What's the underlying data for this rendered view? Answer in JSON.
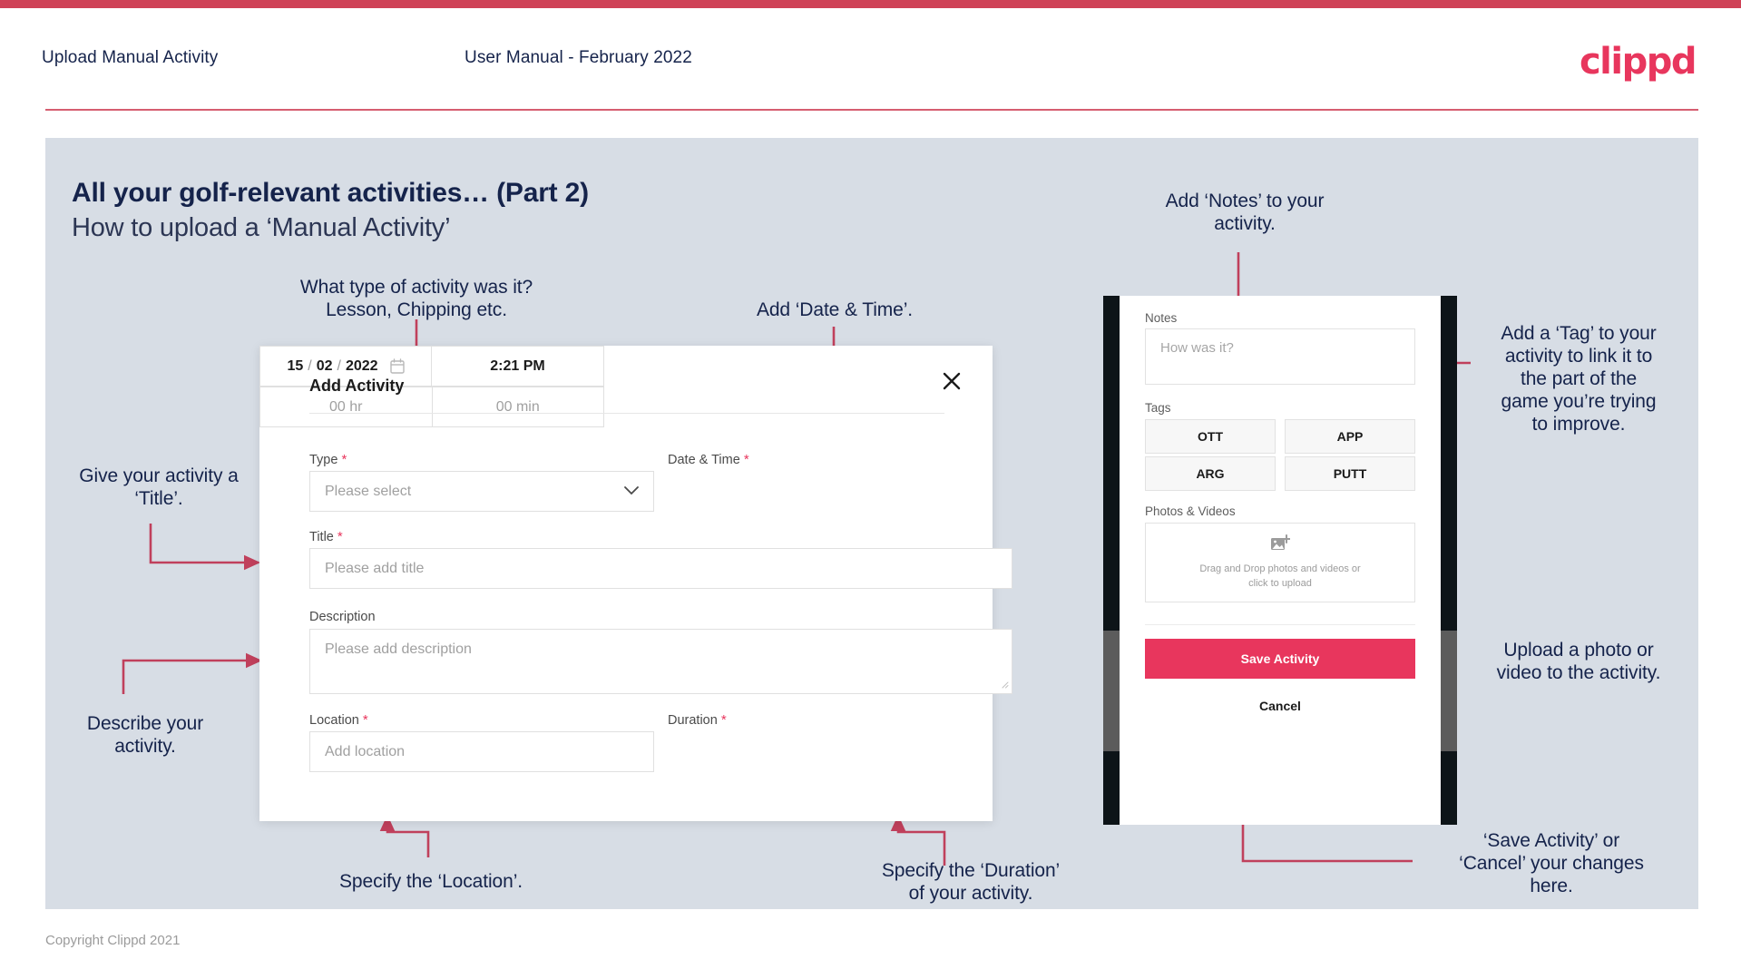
{
  "header": {
    "left_title": "Upload Manual Activity",
    "center_title": "User Manual - February 2022",
    "logo": "clippd"
  },
  "slide": {
    "title_line1": "All your golf-relevant activities… (Part 2)",
    "title_line2": "How to upload a ‘Manual Activity’"
  },
  "dialog": {
    "title": "Add Activity",
    "close_icon": "close-icon",
    "fields": {
      "type": {
        "label": "Type",
        "required": "*",
        "placeholder": "Please select",
        "chevron_icon": "chevron-down-icon"
      },
      "date_time": {
        "label": "Date & Time",
        "required": "*",
        "day": "15",
        "sep1": "/",
        "month": "02",
        "sep2": "/",
        "year": "2022",
        "calendar_icon": "calendar-icon",
        "time": "2:21 PM"
      },
      "title": {
        "label": "Title",
        "required": "*",
        "placeholder": "Please add title"
      },
      "description": {
        "label": "Description",
        "placeholder": "Please add description"
      },
      "location": {
        "label": "Location",
        "required": "*",
        "placeholder": "Add location"
      },
      "duration": {
        "label": "Duration",
        "required": "*",
        "hours_placeholder": "00 hr",
        "minutes_placeholder": "00 min"
      }
    }
  },
  "phone": {
    "notes": {
      "label": "Notes",
      "placeholder": "How was it?"
    },
    "tags": {
      "label": "Tags",
      "items": [
        "OTT",
        "APP",
        "ARG",
        "PUTT"
      ]
    },
    "photos_videos": {
      "label": "Photos & Videos",
      "upload_icon": "add-image-icon",
      "hint_line1": "Drag and Drop photos and videos or",
      "hint_line2": "click to upload"
    },
    "save_label": "Save Activity",
    "cancel_label": "Cancel"
  },
  "annotations": {
    "type": "What type of activity was it?\nLesson, Chipping etc.",
    "date_time": "Add ‘Date & Time’.",
    "title": "Give your activity a\n‘Title’.",
    "description": "Describe your\nactivity.",
    "location": "Specify the ‘Location’.",
    "duration": "Specify the ‘Duration’\nof your activity.",
    "notes": "Add ‘Notes’ to your\nactivity.",
    "tags": "Add a ‘Tag’ to your\nactivity to link it to\nthe part of the\ngame you’re trying\nto improve.",
    "upload": "Upload a photo or\nvideo to the activity.",
    "save_cancel": "‘Save Activity’ or\n‘Cancel’ your changes\nhere."
  },
  "footer": {
    "copyright": "Copyright Clippd 2021"
  },
  "colors": {
    "brand_pink": "#e8365d",
    "accent_rule": "#cf4257",
    "slide_bg": "#d7dde5",
    "navy_text": "#15234b",
    "arrow": "#c0405c"
  }
}
